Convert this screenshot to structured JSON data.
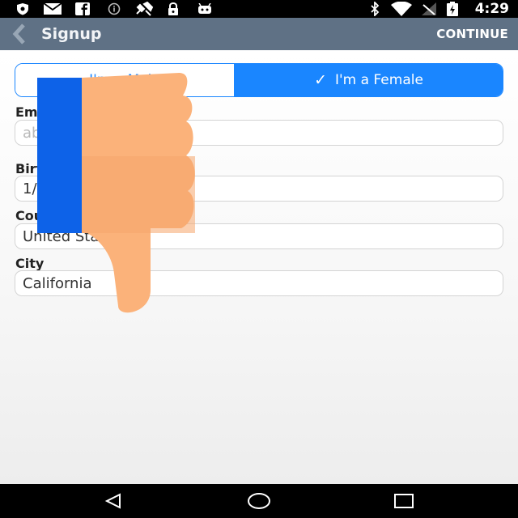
{
  "status_bar": {
    "time": "4:29",
    "icons": [
      "shield-icon",
      "mail-icon",
      "facebook-icon",
      "info-icon",
      "satellite-icon",
      "lock-icon",
      "android-icon",
      "bluetooth-icon",
      "wifi-icon",
      "no-signal-icon",
      "battery-icon"
    ]
  },
  "toolbar": {
    "title": "Signup",
    "continue_label": "CONTINUE",
    "back_icon": "chevron-left-icon"
  },
  "gender": {
    "male_label": "I'm a Male",
    "female_label": "I'm a Female",
    "selected": "female",
    "accent_color": "#1a86ff"
  },
  "form": {
    "email_label": "Email (Private)",
    "email_placeholder": "abc@gmail.com",
    "birthday_label": "Birthday",
    "birthday_value": "1/",
    "country_label": "Country",
    "country_value": "United States",
    "city_label": "City",
    "city_value": "California"
  },
  "navigation": {
    "buttons": [
      "back-triangle-icon",
      "home-circle-icon",
      "recents-square-icon"
    ]
  },
  "colors": {
    "toolbar": "#5f7185",
    "status_bar": "#000000",
    "accent": "#1a86ff"
  }
}
